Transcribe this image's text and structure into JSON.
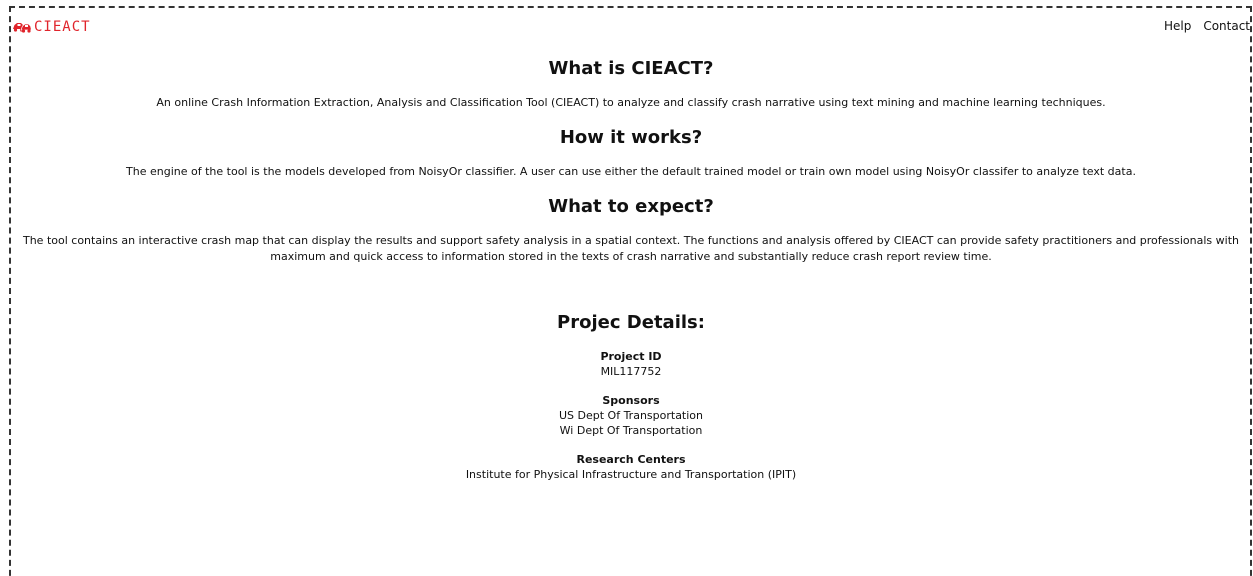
{
  "header": {
    "logo_text": "CIEACT",
    "logo_icon": "cars-icon",
    "brand_color": "#e0242b",
    "nav": {
      "help": "Help",
      "contact": "Contact"
    }
  },
  "sections": {
    "what": {
      "title": "What is CIEACT?",
      "body": "An online Crash Information Extraction, Analysis and Classification Tool (CIEACT) to analyze and classify crash narrative using text mining and machine learning techniques."
    },
    "how": {
      "title": "How it works?",
      "body": "The engine of the tool is the models developed from NoisyOr classifier. A user can use either the default trained model or train own model using NoisyOr classifer to analyze text data."
    },
    "expect": {
      "title": "What to expect?",
      "body": "The tool contains an interactive crash map that can display the results and support safety analysis in a spatial context. The functions and analysis offered by CIEACT can provide safety practitioners and professionals with maximum and quick access to information stored in the texts of crash narrative and substantially reduce crash report review time."
    }
  },
  "project": {
    "title": "Projec Details:",
    "id_label": "Project ID",
    "id_value": "MIL117752",
    "sponsors_label": "Sponsors",
    "sponsors": [
      "US Dept Of Transportation",
      "Wi Dept Of Transportation"
    ],
    "centers_label": "Research Centers",
    "centers": [
      "Institute for Physical Infrastructure and Transportation (IPIT)"
    ]
  }
}
